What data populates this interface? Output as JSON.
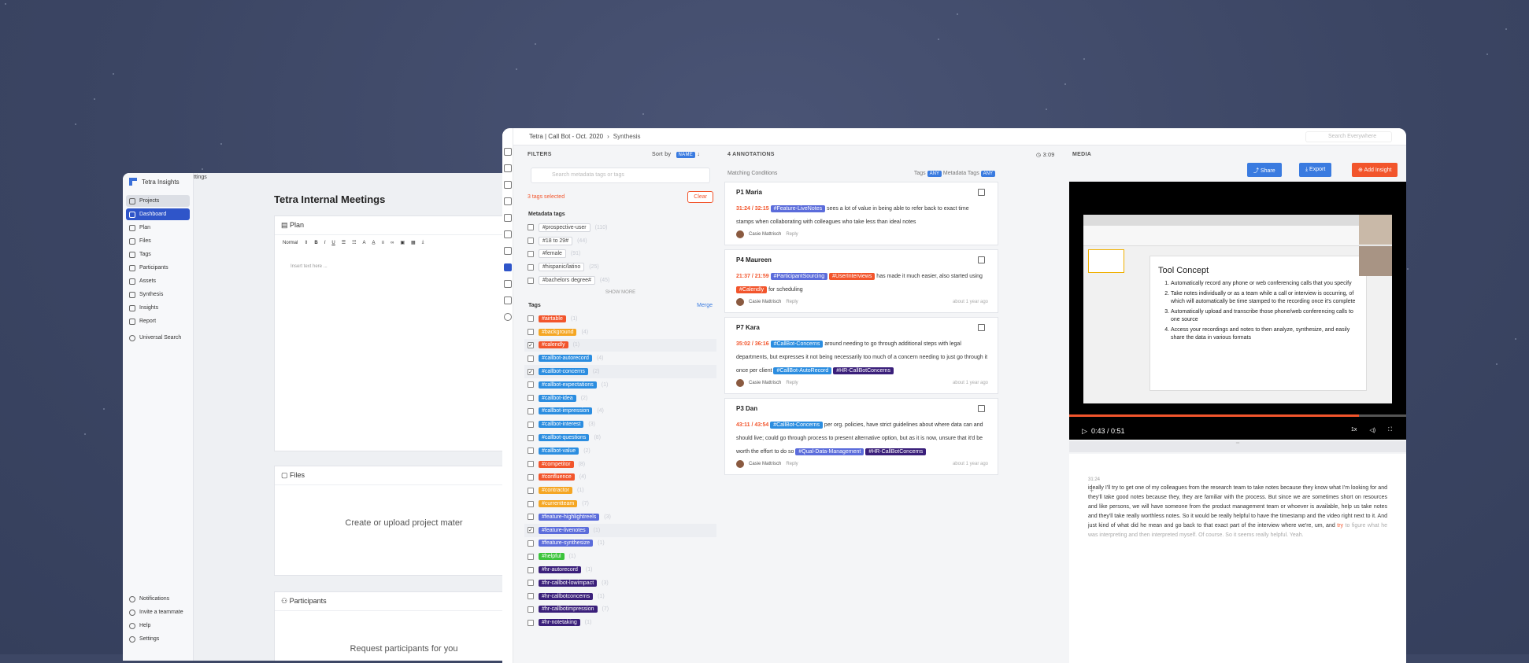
{
  "back": {
    "brand": "Tetra Insights",
    "crumb": "ttings",
    "projects_label": "Projects",
    "nav": [
      "Dashboard",
      "Plan",
      "Files",
      "Tags",
      "Participants",
      "Assets",
      "Synthesis",
      "Insights",
      "Report"
    ],
    "universal_search": "Universal Search",
    "bottom": [
      "Notifications",
      "Invite a teammate",
      "Help",
      "Settings"
    ],
    "title": "Tetra Internal Meetings",
    "plan_label": "Plan",
    "toolbar_normal": "Normal",
    "insert_placeholder": "Insert text here ...",
    "files_label": "Files",
    "files_note": "Create or upload project mater",
    "participants_label": "Participants",
    "participants_note": "Request participants for you"
  },
  "front": {
    "breadcrumb_project": "Tetra | Call Bot - Oct. 2020",
    "breadcrumb_page": "Synthesis",
    "search_placeholder": "Search Everywhere",
    "filters_label": "FILTERS",
    "sort_by": "Sort by",
    "sort_value": "NAME",
    "metadata_search_placeholder": "Search metadata tags or tags",
    "tags_selected": "3 tags selected",
    "clear": "Clear",
    "metadata_tags_label": "Metadata tags",
    "metadata_tags": [
      {
        "name": "#prospective-user",
        "count": "(110)"
      },
      {
        "name": "#18 to 29#",
        "count": "(44)"
      },
      {
        "name": "#female",
        "count": "(91)"
      },
      {
        "name": "#hispanic/latino",
        "count": "(25)"
      },
      {
        "name": "#bachelors degree#",
        "count": "(45)"
      }
    ],
    "show_more": "SHOW MORE",
    "tags_label": "Tags",
    "merge": "Merge",
    "tags": [
      {
        "name": "#airtable",
        "count": "(1)",
        "color": "#f2552c",
        "checked": false
      },
      {
        "name": "#background",
        "count": "(4)",
        "color": "#f5a623",
        "checked": false
      },
      {
        "name": "#calendly",
        "count": "(1)",
        "color": "#f2552c",
        "checked": true
      },
      {
        "name": "#callbot-autorecord",
        "count": "(4)",
        "color": "#2b8de0",
        "checked": false
      },
      {
        "name": "#callbot-concerns",
        "count": "(2)",
        "color": "#2b8de0",
        "checked": true
      },
      {
        "name": "#callbot-expectations",
        "count": "(1)",
        "color": "#2b8de0",
        "checked": false
      },
      {
        "name": "#callbot-idea",
        "count": "(2)",
        "color": "#2b8de0",
        "checked": false
      },
      {
        "name": "#callbot-impression",
        "count": "(4)",
        "color": "#2b8de0",
        "checked": false
      },
      {
        "name": "#callbot-interest",
        "count": "(3)",
        "color": "#2b8de0",
        "checked": false
      },
      {
        "name": "#callbot-questions",
        "count": "(8)",
        "color": "#2b8de0",
        "checked": false
      },
      {
        "name": "#callbot-value",
        "count": "(2)",
        "color": "#2b8de0",
        "checked": false
      },
      {
        "name": "#competitor",
        "count": "(8)",
        "color": "#f2552c",
        "checked": false
      },
      {
        "name": "#confluence",
        "count": "(4)",
        "color": "#f2552c",
        "checked": false
      },
      {
        "name": "#contractor",
        "count": "(1)",
        "color": "#f5a623",
        "checked": false
      },
      {
        "name": "#currentteam",
        "count": "(7)",
        "color": "#f5a623",
        "checked": false
      },
      {
        "name": "#feature-highlightreels",
        "count": "(3)",
        "color": "#5b6cdb",
        "checked": false
      },
      {
        "name": "#feature-livenotes",
        "count": "(1)",
        "color": "#5b6cdb",
        "checked": true
      },
      {
        "name": "#feature-synthesize",
        "count": "(1)",
        "color": "#5b6cdb",
        "checked": false
      },
      {
        "name": "#helpful",
        "count": "(1)",
        "color": "#3cc43c",
        "checked": false
      },
      {
        "name": "#hr-autorecord",
        "count": "(1)",
        "color": "#3a1f7a",
        "checked": false
      },
      {
        "name": "#hr-callbot-lowimpact",
        "count": "(3)",
        "color": "#3a1f7a",
        "checked": false
      },
      {
        "name": "#hr-callbotconcerns",
        "count": "(1)",
        "color": "#3a1f7a",
        "checked": false
      },
      {
        "name": "#hr-callbotimpression",
        "count": "(7)",
        "color": "#3a1f7a",
        "checked": false
      },
      {
        "name": "#hr-notetaking",
        "count": "(1)",
        "color": "#3a1f7a",
        "checked": false
      }
    ],
    "annotations_label": "4 ANNOTATIONS",
    "duration": "3:09",
    "matching_conditions": "Matching Conditions",
    "tags_word": "Tags",
    "metadata_tags_word": "Metadata Tags",
    "any": "ANY",
    "reply": "Reply",
    "annotations": [
      {
        "name": "P1 Maria",
        "ts": "31:24 / 32:15",
        "pre": "",
        "tags": [
          {
            "t": "#Feature-LiveNotes",
            "c": "#5b6cdb"
          }
        ],
        "text": "sees a lot of value in being able to refer back to exact time stamps when collaborating with colleagues who take less than ideal notes",
        "post_tags": [],
        "post": "",
        "author": "Casie Mattrisch",
        "ago": ""
      },
      {
        "name": "P4 Maureen",
        "ts": "21:37 / 21:59",
        "pre": "",
        "tags": [
          {
            "t": "#ParticipantSourcing",
            "c": "#5b6cdb"
          },
          {
            "t": "#UserInterviews",
            "c": "#f2552c"
          }
        ],
        "text": "has made it much easier, also started using",
        "post_tags": [
          {
            "t": "#Calendly",
            "c": "#f2552c"
          }
        ],
        "post": "for scheduling",
        "author": "Casie Mattrisch",
        "ago": "about 1 year ago"
      },
      {
        "name": "P7 Kara",
        "ts": "35:02 / 36:16",
        "pre": "",
        "tags": [
          {
            "t": "#CallBot-Concerns",
            "c": "#2b8de0"
          }
        ],
        "text": "around needing to go through additional steps with legal departments, but expresses it not being necessarily too much of a concern needing to just go through it once per client",
        "post_tags": [
          {
            "t": "#CallBot-AutoRecord",
            "c": "#2b8de0"
          },
          {
            "t": "#HR-CallBotConcerns",
            "c": "#3a1f7a"
          }
        ],
        "post": "",
        "author": "Casie Mattrisch",
        "ago": "about 1 year ago"
      },
      {
        "name": "P3 Dan",
        "ts": "43:11 / 43:54",
        "pre": "",
        "tags": [
          {
            "t": "#CallBot-Concerns",
            "c": "#2b8de0"
          }
        ],
        "text": "per org. policies, have strict guidelines about where data can and should live; could go through process to present alternative option, but as it is now, unsure that it'd be worth the effort to do so",
        "post_tags": [
          {
            "t": "#Qual-Data-Management",
            "c": "#5b6cdb"
          },
          {
            "t": "#HR-CallBotConcerns",
            "c": "#3a1f7a"
          }
        ],
        "post": "",
        "author": "Casie Mattrisch",
        "ago": "about 1 year ago"
      }
    ],
    "media_label": "MEDIA",
    "share": "Share",
    "export": "Export",
    "add_insight": "Add Insight",
    "slide_title": "Tool Concept",
    "slide_items": [
      "Automatically record any phone or web conferencing calls that you specify",
      "Take notes individually or as a team while a call or interview is occurring, of which will automatically be time stamped to the recording once it's complete",
      "Automatically upload and transcribe those phone/web conferencing calls to one source",
      "Access your recordings and notes to then analyze, synthesize, and easily share the data in various formats"
    ],
    "time": "0:43 / 0:51",
    "speed": "1x",
    "progress": 0.86,
    "transcript_time": "31:24",
    "transcript_main": "ideally I'll try to get one of my colleagues from the research team to take notes because they know what I'm looking for and they'll take good notes because they, they are familiar with the process. But since we are sometimes short on resources and like persons, we will have someone from the product management team or whoever is available, help us take notes and they'll take really worthless notes. So it would be really helpful to have the timestamp and the video right next to it. And just kind of what did he mean and go back to that exact part of the interview where we're, um, and",
    "transcript_hl": "try",
    "transcript_rest": "to figure what he was interpreting and then interpreted myself. Of course. So it seems really helpful. Yeah."
  }
}
